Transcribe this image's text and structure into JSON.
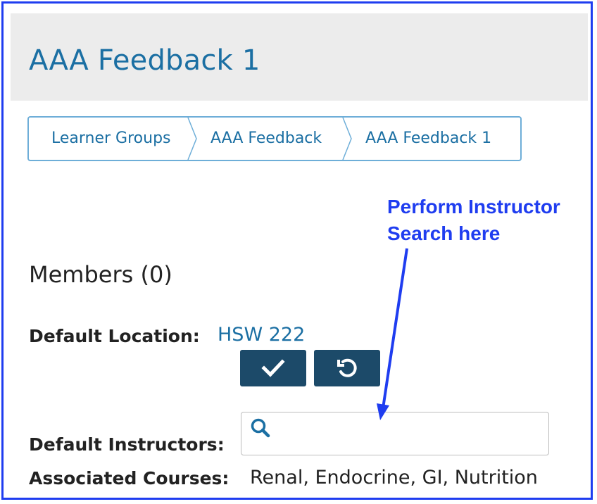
{
  "page": {
    "title": "AAA Feedback 1"
  },
  "breadcrumb": [
    {
      "label": "Learner Groups"
    },
    {
      "label": "AAA Feedback"
    },
    {
      "label": "AAA Feedback 1"
    }
  ],
  "annotation": {
    "line1": "Perform Instructor",
    "line2": "Search here",
    "color": "#1f3df0"
  },
  "members": {
    "heading": "Members (0)"
  },
  "default_location": {
    "label": "Default Location:",
    "value": "HSW 222"
  },
  "actions": {
    "save_icon": "check-icon",
    "revert_icon": "undo-icon"
  },
  "default_instructors": {
    "label": "Default Instructors:",
    "search_value": ""
  },
  "associated_courses": {
    "label": "Associated Courses:",
    "value": "Renal, Endocrine, GI, Nutrition"
  },
  "colors": {
    "accent": "#1b6fa3",
    "button": "#1c4a69",
    "header_bg": "#ececec",
    "frame": "#1f3df0"
  }
}
